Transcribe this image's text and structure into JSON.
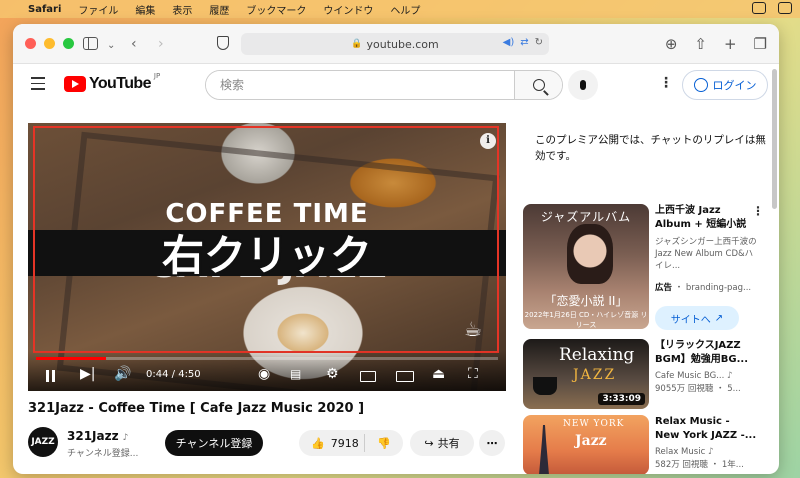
{
  "menubar": {
    "app": "Safari",
    "items": [
      "ファイル",
      "編集",
      "表示",
      "履歴",
      "ブックマーク",
      "ウインドウ",
      "ヘルプ"
    ]
  },
  "browser": {
    "url": "youtube.com"
  },
  "youtube": {
    "logo_text": "YouTube",
    "logo_region": "JP",
    "search_placeholder": "検索",
    "login_label": "ログイン"
  },
  "player": {
    "overlay_line1": "COFFEE TIME",
    "overlay_line2": "CAFE JAZZ",
    "annotation": "右クリック",
    "current_time": "0:44",
    "duration": "4:50",
    "progress_fraction": 0.152,
    "info_label": "i",
    "annotation_color": "#e53426"
  },
  "video": {
    "title": "321Jazz - Coffee Time [ Cafe Jazz Music 2020 ]",
    "channel_name": "321Jazz",
    "channel_avatar_text": "JAZZ",
    "channel_subs": "チャンネル登録...",
    "subscribe_label": "チャンネル登録",
    "likes": "7918",
    "share_label": "共有"
  },
  "sidebar": {
    "premiere_note": "このプレミア公開では、チャットのリプレイは無効です。",
    "ad": {
      "thumb_top": "ジャズアルバム",
      "thumb_main": "「恋愛小説 II」",
      "thumb_sub": "2022年1月26日 CD・ハイレゾ音源 リリース",
      "title": "上西千波 Jazz Album + 短編小説",
      "description": "ジャズシンガー上西千波のJazz New Album CD&ハイレ...",
      "ad_label": "広告",
      "ad_domain": "branding-pag...",
      "site_button": "サイトへ"
    },
    "recommendations": [
      {
        "thumb_text1": "Relaxing",
        "thumb_text2": "JAZZ",
        "duration": "3:33:09",
        "title": "【リラックスJAZZ BGM】勉強用BG...",
        "channel": "Cafe Music BG...",
        "stats": "9055万 回視聴 ・ 5..."
      },
      {
        "thumb_text1": "NEW YORK",
        "thumb_text2": "Jazz",
        "title": "Relax Music - New York JAZZ -...",
        "channel": "Relax Music",
        "stats": "582万 回視聴 ・ 1年..."
      }
    ]
  }
}
